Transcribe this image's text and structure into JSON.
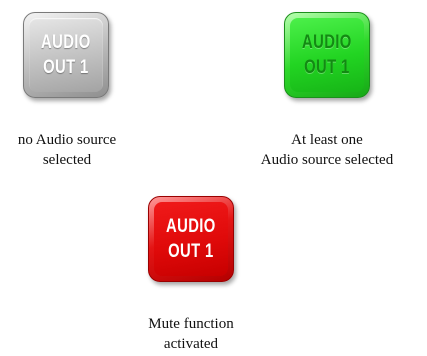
{
  "buttons": [
    {
      "state": "no-source",
      "label_line1": "AUDIO",
      "label_line2": "OUT 1",
      "color": "#b9b9b9",
      "caption_line1": "no Audio source",
      "caption_line2": "selected"
    },
    {
      "state": "source-selected",
      "label_line1": "AUDIO",
      "label_line2": "OUT 1",
      "color": "#22d422",
      "caption_line1": "At least one",
      "caption_line2": "Audio source selected"
    },
    {
      "state": "muted",
      "label_line1": "AUDIO",
      "label_line2": "OUT 1",
      "color": "#e00a0a",
      "caption_line1": "Mute function",
      "caption_line2": "activated"
    }
  ]
}
